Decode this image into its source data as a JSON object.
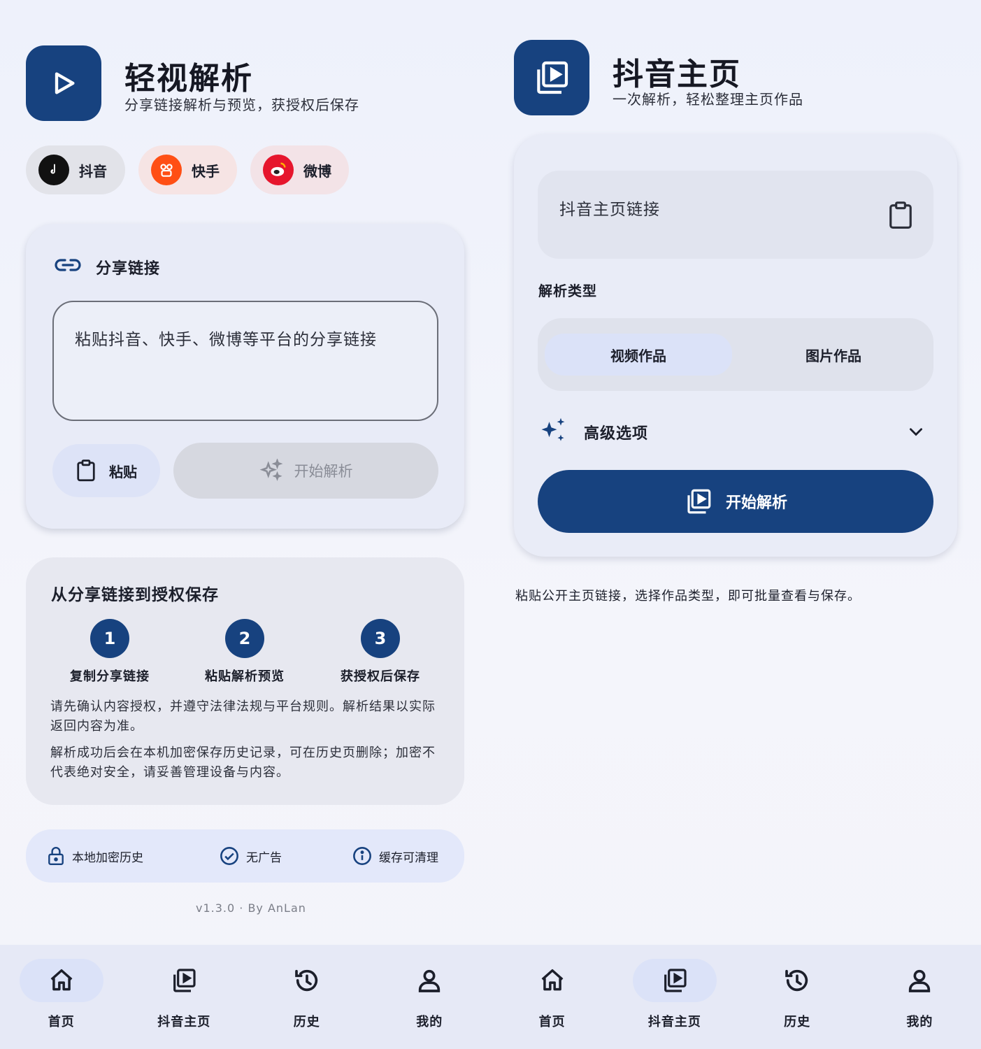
{
  "left": {
    "app": {
      "title": "轻视解析",
      "subtitle": "分享链接解析与预览，获授权后保存"
    },
    "platforms": [
      {
        "label": "抖音",
        "color": "#111111",
        "bg": "#e2e3e9"
      },
      {
        "label": "快手",
        "color": "#ff4f14",
        "bg": "#f6e4e4"
      },
      {
        "label": "微博",
        "color": "#e6162d",
        "bg": "#f3e3e7"
      }
    ],
    "share_card": {
      "title": "分享链接",
      "placeholder": "粘贴抖音、快手、微博等平台的分享链接",
      "paste_label": "粘贴",
      "start_label": "开始解析"
    },
    "steps_card": {
      "title": "从分享链接到授权保存",
      "steps": [
        {
          "num": "1",
          "label": "复制分享链接"
        },
        {
          "num": "2",
          "label": "粘贴解析预览"
        },
        {
          "num": "3",
          "label": "获授权后保存"
        }
      ],
      "para1": "请先确认内容授权，并遵守法律法规与平台规则。解析结果以实际返回内容为准。",
      "para2": "解析成功后会在本机加密保存历史记录，可在历史页删除；加密不代表绝对安全，请妥善管理设备与内容。"
    },
    "features": [
      {
        "icon": "lock-icon",
        "label": "本地加密历史"
      },
      {
        "icon": "check-circle-icon",
        "label": "无广告"
      },
      {
        "icon": "info-icon",
        "label": "缓存可清理"
      }
    ],
    "version": "v1.3.0 · By AnLan"
  },
  "right": {
    "app": {
      "title": "抖音主页",
      "subtitle": "一次解析，轻松整理主页作品"
    },
    "input_label": "抖音主页链接",
    "parse_type_label": "解析类型",
    "parse_types": [
      {
        "label": "视频作品",
        "active": true
      },
      {
        "label": "图片作品",
        "active": false
      }
    ],
    "advanced_label": "高级选项",
    "start_label": "开始解析",
    "note": "粘贴公开主页链接，选择作品类型，即可批量查看与保存。"
  },
  "nav_left": {
    "active": 0,
    "items": [
      {
        "icon": "home-icon",
        "label": "首页"
      },
      {
        "icon": "video-library-icon",
        "label": "抖音主页"
      },
      {
        "icon": "history-icon",
        "label": "历史"
      },
      {
        "icon": "person-icon",
        "label": "我的"
      }
    ]
  },
  "nav_right": {
    "active": 1,
    "items": [
      {
        "icon": "home-icon",
        "label": "首页"
      },
      {
        "icon": "video-library-icon",
        "label": "抖音主页"
      },
      {
        "icon": "history-icon",
        "label": "历史"
      },
      {
        "icon": "person-icon",
        "label": "我的"
      }
    ]
  },
  "colors": {
    "brand": "#17427f",
    "background": "#eef1fb",
    "card": "#e8ebf7"
  }
}
